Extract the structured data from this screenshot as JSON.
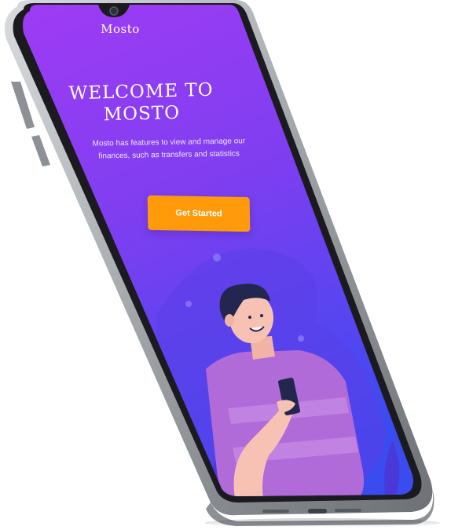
{
  "app": {
    "name": "Mosto"
  },
  "onboarding": {
    "title_line1": "WELCOME TO",
    "title_line2": "MOSTO",
    "tagline": "Mosto has features to view and manage our finances, such as transfers and statistics",
    "cta_label": "Get Started"
  },
  "colors": {
    "gradient_top": "#9b3cf2",
    "gradient_bottom": "#3a4bf0",
    "cta": "#ff9a0a",
    "device_frame": "#b9bcc1"
  },
  "illustration": {
    "subject": "person-holding-phone",
    "shirt_color": "#b06bd8",
    "hair_color": "#23264f"
  }
}
